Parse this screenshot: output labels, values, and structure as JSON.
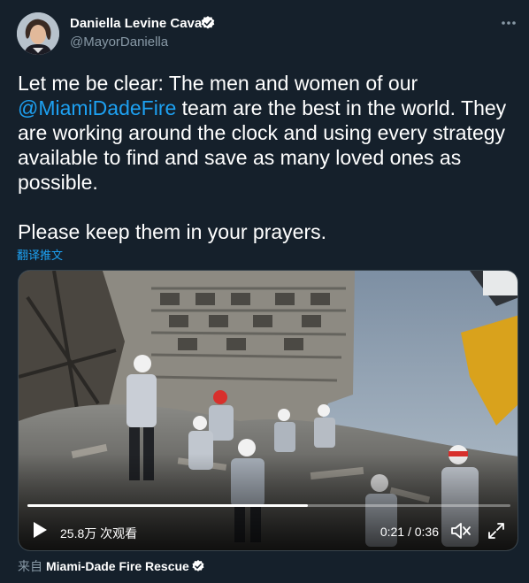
{
  "author": {
    "display_name": "Daniella Levine Cava",
    "handle": "@MayorDaniella",
    "verified": true
  },
  "tweet": {
    "text_before_mention": "Let me be clear: The men and women of our ",
    "mention": "@MiamiDadeFire",
    "text_after_mention": " team are the best in the world. They are working around the clock and using every strategy available to find and save as many loved ones as possible.",
    "second_paragraph": "Please keep them in your prayers.",
    "translate_label": "翻译推文"
  },
  "video": {
    "views": "25.8万 次观看",
    "current_time": "0:21",
    "time_separator": " / ",
    "duration": "0:36",
    "progress": 0.58
  },
  "source": {
    "label": "来自",
    "name": "Miami-Dade Fire Rescue",
    "verified": true
  },
  "colors": {
    "background": "#15202b",
    "accent": "#1da1f2",
    "secondary_text": "#8899a6"
  },
  "icons": [
    "verified-badge-icon",
    "more-options-icon",
    "play-icon",
    "volume-muted-icon",
    "fullscreen-icon"
  ]
}
